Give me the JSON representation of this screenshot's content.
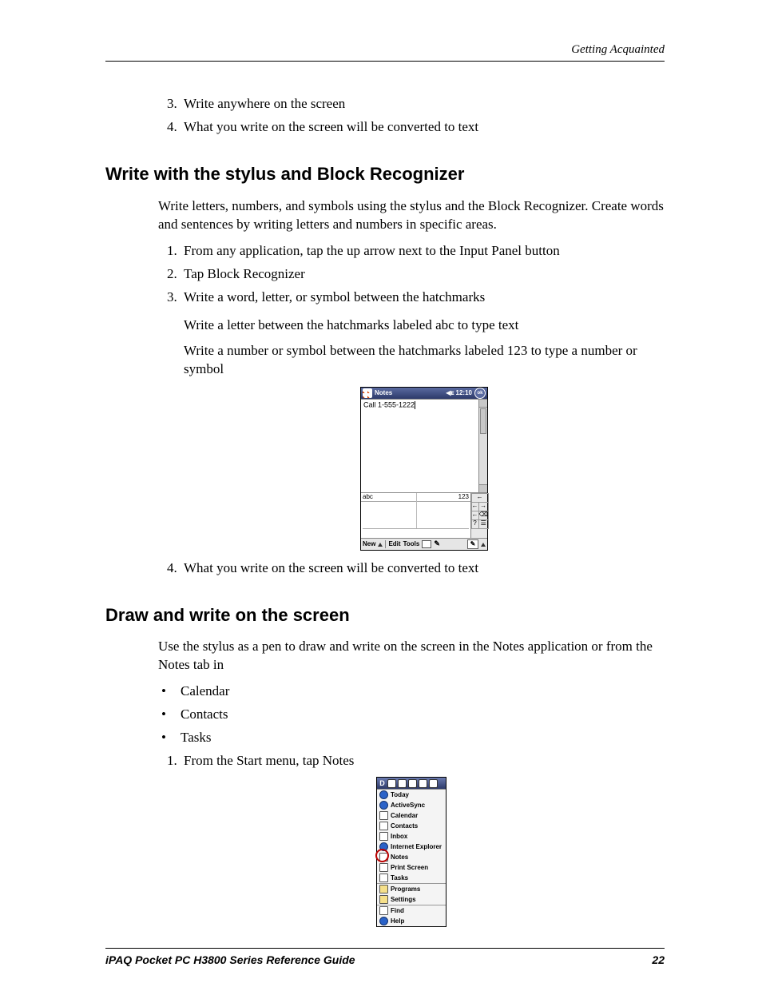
{
  "header": {
    "running": "Getting Acquainted"
  },
  "sec0": {
    "items": [
      "Write anywhere on the screen",
      "What you write on the screen will be converted to text"
    ]
  },
  "sec1": {
    "title": "Write with the stylus and Block Recognizer",
    "intro": "Write letters, numbers, and symbols using the stylus and the Block Recognizer. Create words and sentences by writing letters and numbers in specific areas.",
    "steps": [
      "From any application, tap the up arrow next to the Input Panel button",
      "Tap Block Recognizer",
      "Write a word, letter, or symbol between the hatchmarks",
      "What you write on the screen will be converted to text"
    ],
    "sub": [
      "Write a letter between the hatchmarks labeled abc to type text",
      "Write a number or symbol between the hatchmarks labeled 123 to type a number or symbol"
    ],
    "fig": {
      "title": "Notes",
      "time": "12:10",
      "speaker": "◀ᴇ",
      "ok": "ok",
      "noteText": "Call 1-555-1222",
      "abc": "abc",
      "n123": "123",
      "sidekeys": [
        "←",
        "",
        "←",
        "→",
        "←",
        "⌫",
        "?",
        "☰"
      ],
      "bottom": {
        "new": "New",
        "edit": "Edit",
        "tools": "Tools"
      }
    }
  },
  "sec2": {
    "title": "Draw and write on the screen",
    "intro": "Use the stylus as a pen to draw and write on the screen in the Notes application or from the Notes tab in",
    "bullets": [
      "Calendar",
      "Contacts",
      "Tasks"
    ],
    "steps": [
      "From the Start menu, tap Notes"
    ],
    "fig": {
      "iconrow_label": "D",
      "items_top": [
        "Today",
        "ActiveSync",
        "Calendar",
        "Contacts",
        "Inbox",
        "Internet Explorer",
        "Notes",
        "Print Screen",
        "Tasks"
      ],
      "items_mid": [
        "Programs",
        "Settings"
      ],
      "items_bot": [
        "Find",
        "Help"
      ]
    }
  },
  "footer": {
    "left": "iPAQ Pocket PC H3800 Series Reference Guide",
    "right": "22"
  }
}
